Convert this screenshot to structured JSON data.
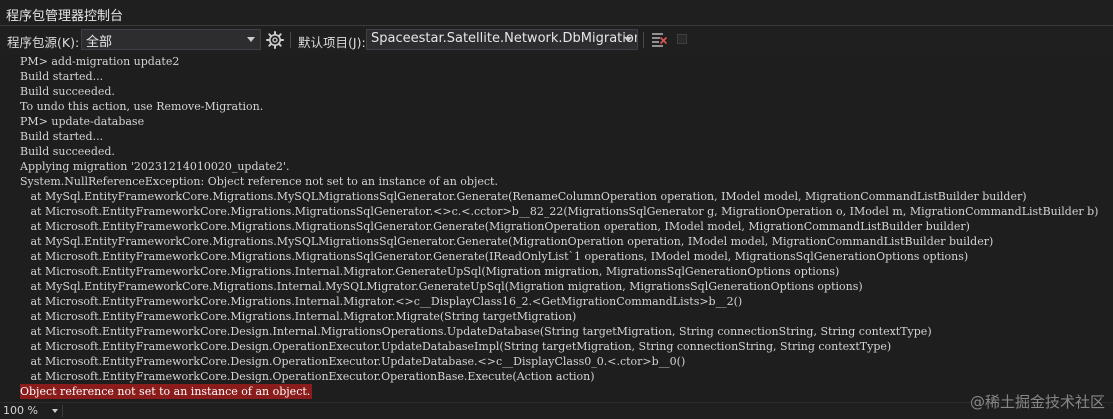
{
  "window": {
    "title": "程序包管理器控制台"
  },
  "toolbar": {
    "source_label": "程序包源(K):",
    "source_value": "全部",
    "settings_icon": "gear-icon",
    "project_label": "默认项目(J):",
    "project_value": "Spaceestar.Satellite.Network.DbMigration",
    "clear_icon": "clear-console-icon",
    "stop_icon": "stop-icon"
  },
  "console": {
    "lines": [
      {
        "text": "PM> add-migration update2",
        "type": "normal"
      },
      {
        "text": "Build started...",
        "type": "normal"
      },
      {
        "text": "Build succeeded.",
        "type": "normal"
      },
      {
        "text": "To undo this action, use Remove-Migration.",
        "type": "normal"
      },
      {
        "text": "PM> update-database",
        "type": "normal"
      },
      {
        "text": "Build started...",
        "type": "normal"
      },
      {
        "text": "Build succeeded.",
        "type": "normal"
      },
      {
        "text": "Applying migration '20231214010020_update2'.",
        "type": "normal"
      },
      {
        "text": "System.NullReferenceException: Object reference not set to an instance of an object.",
        "type": "normal"
      },
      {
        "text": "   at MySql.EntityFrameworkCore.Migrations.MySQLMigrationsSqlGenerator.Generate(RenameColumnOperation operation, IModel model, MigrationCommandListBuilder builder)",
        "type": "normal"
      },
      {
        "text": "   at Microsoft.EntityFrameworkCore.Migrations.MigrationsSqlGenerator.<>c.<.cctor>b__82_22(MigrationsSqlGenerator g, MigrationOperation o, IModel m, MigrationCommandListBuilder b)",
        "type": "normal"
      },
      {
        "text": "   at Microsoft.EntityFrameworkCore.Migrations.MigrationsSqlGenerator.Generate(MigrationOperation operation, IModel model, MigrationCommandListBuilder builder)",
        "type": "normal"
      },
      {
        "text": "   at MySql.EntityFrameworkCore.Migrations.MySQLMigrationsSqlGenerator.Generate(MigrationOperation operation, IModel model, MigrationCommandListBuilder builder)",
        "type": "normal"
      },
      {
        "text": "   at Microsoft.EntityFrameworkCore.Migrations.MigrationsSqlGenerator.Generate(IReadOnlyList`1 operations, IModel model, MigrationsSqlGenerationOptions options)",
        "type": "normal"
      },
      {
        "text": "   at Microsoft.EntityFrameworkCore.Migrations.Internal.Migrator.GenerateUpSql(Migration migration, MigrationsSqlGenerationOptions options)",
        "type": "normal"
      },
      {
        "text": "   at MySql.EntityFrameworkCore.Migrations.Internal.MySQLMigrator.GenerateUpSql(Migration migration, MigrationsSqlGenerationOptions options)",
        "type": "normal"
      },
      {
        "text": "   at Microsoft.EntityFrameworkCore.Migrations.Internal.Migrator.<>c__DisplayClass16_2.<GetMigrationCommandLists>b__2()",
        "type": "normal"
      },
      {
        "text": "   at Microsoft.EntityFrameworkCore.Migrations.Internal.Migrator.Migrate(String targetMigration)",
        "type": "normal"
      },
      {
        "text": "   at Microsoft.EntityFrameworkCore.Design.Internal.MigrationsOperations.UpdateDatabase(String targetMigration, String connectionString, String contextType)",
        "type": "normal"
      },
      {
        "text": "   at Microsoft.EntityFrameworkCore.Design.OperationExecutor.UpdateDatabaseImpl(String targetMigration, String connectionString, String contextType)",
        "type": "normal"
      },
      {
        "text": "   at Microsoft.EntityFrameworkCore.Design.OperationExecutor.UpdateDatabase.<>c__DisplayClass0_0.<.ctor>b__0()",
        "type": "normal"
      },
      {
        "text": "   at Microsoft.EntityFrameworkCore.Design.OperationExecutor.OperationBase.Execute(Action action)",
        "type": "normal"
      },
      {
        "text": "Object reference not set to an instance of an object.",
        "type": "error"
      }
    ]
  },
  "statusbar": {
    "zoom": "100 %"
  },
  "watermark": {
    "text": "@稀土掘金技术社区"
  },
  "colors": {
    "background": "#1e1e1e",
    "text": "#d4d4d4",
    "error_highlight": "#8a1c1c"
  }
}
